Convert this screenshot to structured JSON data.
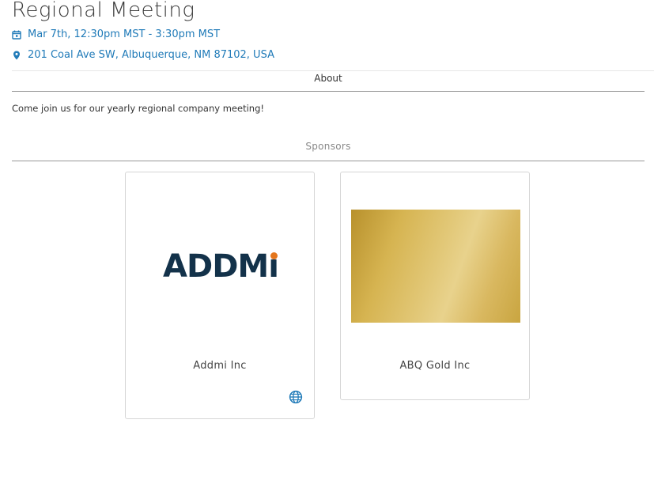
{
  "event": {
    "title": "Regional Meeting",
    "date_time": "Mar 7th, 12:30pm MST - 3:30pm MST",
    "location": "201 Coal Ave SW, Albuquerque, NM 87102, USA"
  },
  "about": {
    "tab_label": "About",
    "description": "Come join us for our yearly regional company meeting!"
  },
  "sponsors": {
    "heading": "Sponsors",
    "items": [
      {
        "name": "Addmi Inc",
        "logo_text": "ADDMı",
        "has_website": true
      },
      {
        "name": "ABQ Gold Inc",
        "has_website": false
      }
    ]
  },
  "colors": {
    "accent": "#1f7ab8",
    "addmi_navy": "#13324a",
    "addmi_orange": "#e4761d"
  },
  "icons": {
    "date": "calendar-icon",
    "location": "map-pin-icon",
    "website": "globe-icon"
  }
}
